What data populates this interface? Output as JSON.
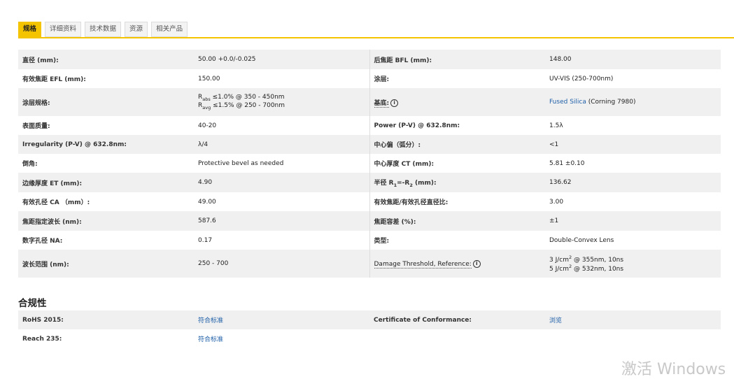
{
  "tabs": [
    {
      "label": "规格",
      "active": true
    },
    {
      "label": "详细资料",
      "active": false
    },
    {
      "label": "技术数据",
      "active": false
    },
    {
      "label": "资源",
      "active": false
    },
    {
      "label": "相关产品",
      "active": false
    }
  ],
  "specs": [
    {
      "l1": "直径 (mm):",
      "v1": "50.00 +0.0/-0.025",
      "l2": "后焦距 BFL (mm):",
      "v2": "148.00"
    },
    {
      "l1": "有效焦距 EFL (mm):",
      "v1": "150.00",
      "l2": "涂层:",
      "v2": "UV-VIS (250-700nm)"
    },
    {
      "l1": "涂层规格:",
      "v1a_pre": "R",
      "v1a_sub": "abs",
      "v1a_post": " ≤1.0% @ 350 - 450nm",
      "v1b_pre": "R",
      "v1b_sub": "avg",
      "v1b_post": " ≤1.5% @ 250 - 700nm",
      "l2": "基底:",
      "v2_link": "Fused Silica",
      "v2_rest": " (Corning 7980)"
    },
    {
      "l1": "表面质量:",
      "v1": "40-20",
      "l2": "Power (P-V) @ 632.8nm:",
      "v2": "1.5λ"
    },
    {
      "l1": "Irregularity (P-V) @ 632.8nm:",
      "v1": "λ/4",
      "l2": "中心偏（弧分）:",
      "v2": "<1"
    },
    {
      "l1": "倒角:",
      "v1": "Protective bevel as needed",
      "l2": "中心厚度 CT (mm):",
      "v2": "5.81 ±0.10"
    },
    {
      "l1": "边缘厚度 ET (mm):",
      "v1": "4.90",
      "l2_pre": "半径 R",
      "l2_sub1": "1",
      "l2_mid": "=-R",
      "l2_sub2": "2",
      "l2_post": " (mm):",
      "v2": "136.62"
    },
    {
      "l1": "有效孔径 CA （mm）:",
      "v1": "49.00",
      "l2": "有效焦距/有效孔径直径比:",
      "v2": "3.00"
    },
    {
      "l1": "焦距指定波长 (nm):",
      "v1": "587.6",
      "l2": "焦距容差 (%):",
      "v2": "±1"
    },
    {
      "l1": "数字孔径 NA:",
      "v1": "0.17",
      "l2": "类型:",
      "v2": "Double-Convex Lens"
    },
    {
      "l1": "波长范围 (nm):",
      "v1": "250 - 700",
      "l2": "Damage Threshold, Reference:",
      "v2a_pre": "3 J/cm",
      "v2a_sup": "2",
      "v2a_post": " @ 355nm, 10ns",
      "v2b_pre": "5 J/cm",
      "v2b_sup": "2",
      "v2b_post": " @ 532nm, 10ns"
    }
  ],
  "info_icon_glyph": "i",
  "compliance": {
    "title": "合规性",
    "rows": [
      {
        "l1": "RoHS 2015:",
        "v1": "符合标准",
        "l2": "Certificate of Conformance:",
        "v2": "浏览"
      },
      {
        "l1": "Reach 235:",
        "v1": "符合标准",
        "l2": "",
        "v2": ""
      }
    ]
  },
  "watermark": "激活 Windows",
  "colors": {
    "accent": "#f5c400",
    "link": "#1f5fa8",
    "row_shade": "#f0f0f0"
  }
}
